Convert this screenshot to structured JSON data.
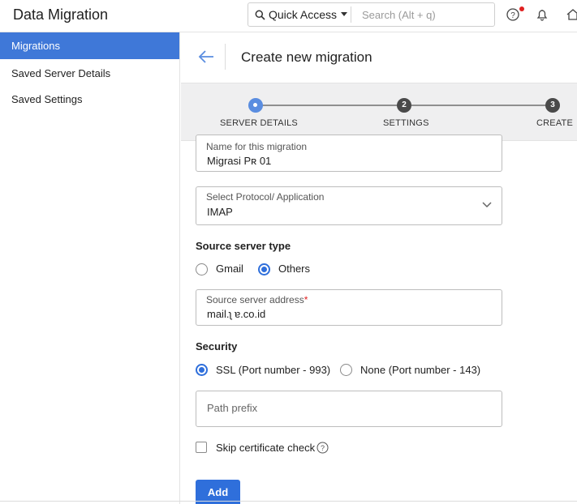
{
  "app": {
    "title": "Data Migration"
  },
  "topbar": {
    "quick_access_label": "Quick Access",
    "search_placeholder": "Search (Alt + q)",
    "icons": [
      "help-icon",
      "bell-icon",
      "home-icon"
    ],
    "notification_color": "#e02020"
  },
  "sidebar": {
    "items": [
      {
        "label": "Migrations",
        "active": true
      },
      {
        "label": "Saved Server Details",
        "active": false
      },
      {
        "label": "Saved Settings",
        "active": false
      }
    ]
  },
  "main": {
    "title": "Create new migration",
    "steps": [
      {
        "number": "",
        "label": "SERVER DETAILS",
        "state": "active"
      },
      {
        "number": "2",
        "label": "SETTINGS",
        "state": "pending"
      },
      {
        "number": "3",
        "label": "CREATE",
        "state": "pending"
      }
    ],
    "form": {
      "name": {
        "label": "Name for this migration",
        "value": "Migrasi Pʀ         01"
      },
      "protocol": {
        "label": "Select Protocol/ Application",
        "value": "IMAP"
      },
      "source_type": {
        "title": "Source server type",
        "options": [
          {
            "label": "Gmail",
            "checked": false
          },
          {
            "label": "Others",
            "checked": true
          }
        ]
      },
      "server_address": {
        "label": "Source server address",
        "required_mark": "*",
        "value": "mail.ʅ         ɐ.co.id"
      },
      "security": {
        "title": "Security",
        "options": [
          {
            "label": "SSL (Port number - 993)",
            "checked": true
          },
          {
            "label": "None (Port number - 143)",
            "checked": false
          }
        ]
      },
      "path_prefix": {
        "placeholder": "Path prefix"
      },
      "skip_cert": {
        "label": "Skip certificate check",
        "checked": false
      },
      "add_button": "Add"
    }
  },
  "colors": {
    "accent": "#2f6fdb",
    "sidebar_active": "#3f78d8",
    "stepper_bg": "#efeff0"
  }
}
